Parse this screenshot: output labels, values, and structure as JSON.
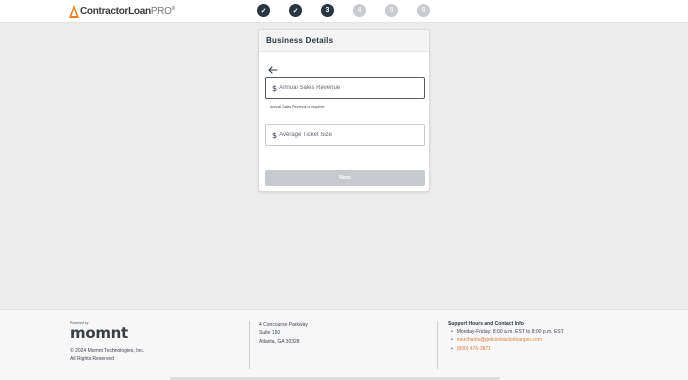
{
  "brand": {
    "logo_main": "ContractorLoan",
    "logo_pro": "PRO",
    "logo_tm": "®",
    "accent": "#f07d1f"
  },
  "steps": [
    {
      "label": "✓",
      "state": "done"
    },
    {
      "label": "✓",
      "state": "done"
    },
    {
      "label": "3",
      "state": "current"
    },
    {
      "label": "4",
      "state": "todo"
    },
    {
      "label": "5",
      "state": "todo"
    },
    {
      "label": "6",
      "state": "todo"
    }
  ],
  "form": {
    "title": "Business Details",
    "back_icon": "arrow-left-icon",
    "currency_symbol": "$",
    "annual_sales": {
      "placeholder": "Annual Sales Revenue",
      "value": "",
      "error": "Annual Sales Revenue is required"
    },
    "avg_ticket": {
      "placeholder": "Average Ticket Size",
      "value": ""
    },
    "next_label": "Next"
  },
  "footer": {
    "powered_by": "Powered by",
    "brand": "momnt",
    "copyright": "© 2024 Momnt Technologies, Inc.",
    "rights": "All Rights Reserved",
    "address": [
      "4 Concourse Parkway",
      "Suite 150",
      "Atlanta, GA 30328"
    ],
    "support_title": "Support Hours and Contact Info",
    "hours": "Monday-Friday: 8:00 a.m. EST to 8:00 p.m. EST",
    "email": "merchants@getcontractorloanpro.com",
    "phone": "(800) 476-3871"
  },
  "colors": {
    "primary": "#2a3542",
    "disabled": "#c6c9cd",
    "link": "#e07b39"
  }
}
